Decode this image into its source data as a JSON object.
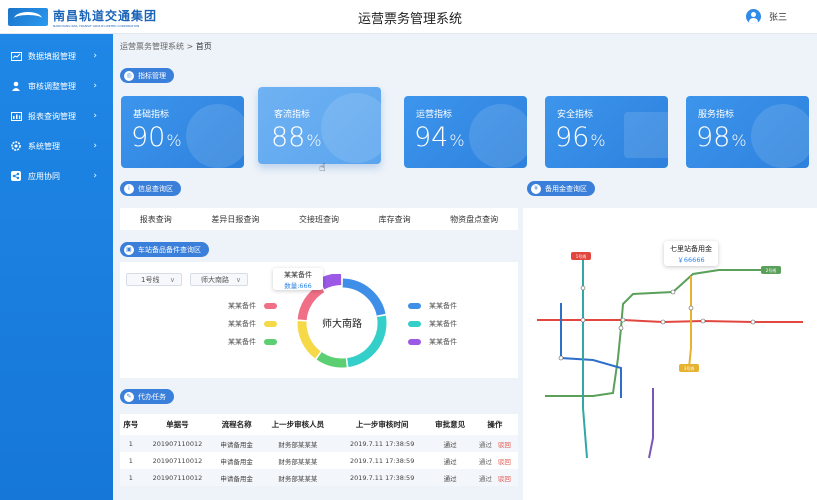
{
  "header": {
    "logo_cn": "南昌轨道交通集团",
    "logo_en": "NANCHANG RAIL TRANSIT GROUP LIMITED CORPORATION",
    "title": "运营票务管理系统",
    "user_name": "张三"
  },
  "sidebar": {
    "items": [
      {
        "label": "数据填报管理",
        "icon": "chart-icon"
      },
      {
        "label": "审核调整管理",
        "icon": "user-icon"
      },
      {
        "label": "报表查询管理",
        "icon": "report-icon"
      },
      {
        "label": "系统管理",
        "icon": "gear-icon"
      },
      {
        "label": "应用协同",
        "icon": "share-icon"
      }
    ]
  },
  "breadcrumb": {
    "parent": "运营票务管理系统",
    "sep": ">",
    "current": "首页"
  },
  "sections": {
    "metrics": "指标管理",
    "info_query": "信息查询区",
    "spare_query": "车站备品备件查询区",
    "todo": "代办任务",
    "reserve_query": "备用金查询区"
  },
  "metrics": [
    {
      "label": "基础指标",
      "value": "90",
      "unit": "%"
    },
    {
      "label": "客流指标",
      "value": "88",
      "unit": "%"
    },
    {
      "label": "运营指标",
      "value": "94",
      "unit": "%"
    },
    {
      "label": "安全指标",
      "value": "96",
      "unit": "%"
    },
    {
      "label": "服务指标",
      "value": "98",
      "unit": "%"
    }
  ],
  "tabs": [
    "报表查询",
    "差异日报查询",
    "交接班查询",
    "库存查询",
    "物资盘点查询"
  ],
  "spare": {
    "line_select": "1号线",
    "station_select": "师大南路",
    "center_label": "师大南路",
    "tooltip_title": "某某备件",
    "tooltip_value": "数量:666",
    "legend_left": [
      {
        "label": "某某备件",
        "color": "#f06f86"
      },
      {
        "label": "某某备件",
        "color": "#f5d949"
      },
      {
        "label": "某某备件",
        "color": "#5ccf73"
      }
    ],
    "legend_right": [
      {
        "label": "某某备件",
        "color": "#3f8fe8"
      },
      {
        "label": "某某备件",
        "color": "#35cfc9"
      },
      {
        "label": "某某备件",
        "color": "#9b59e6"
      }
    ],
    "donut": [
      {
        "color": "#3f8fe8",
        "value": 22
      },
      {
        "color": "#35cfc9",
        "value": 26
      },
      {
        "color": "#5ccf73",
        "value": 12
      },
      {
        "color": "#f5d949",
        "value": 16
      },
      {
        "color": "#f06f86",
        "value": 16
      },
      {
        "color": "#9b59e6",
        "value": 8
      }
    ]
  },
  "todo_table": {
    "headers": [
      "序号",
      "单据号",
      "流程名称",
      "上一步审核人员",
      "上一步审核时间",
      "审批意见",
      "操作"
    ],
    "rows": [
      [
        "1",
        "201907110012",
        "申请备用金",
        "财务部某某某",
        "2019.7.11 17:38:59",
        "通过"
      ],
      [
        "1",
        "201907110012",
        "申请备用金",
        "财务部某某某",
        "2019.7.11 17:38:59",
        "通过"
      ],
      [
        "1",
        "201907110012",
        "申请备用金",
        "财务部某某某",
        "2019.7.11 17:38:59",
        "通过"
      ]
    ],
    "op_pass": "通过",
    "op_reject": "驳回"
  },
  "reserve_map": {
    "tip_title": "七里站备用金",
    "tip_value": "￥66666",
    "line1_tag": "1号线",
    "line2_tag": "2号线",
    "line3_tag": "3号线"
  }
}
